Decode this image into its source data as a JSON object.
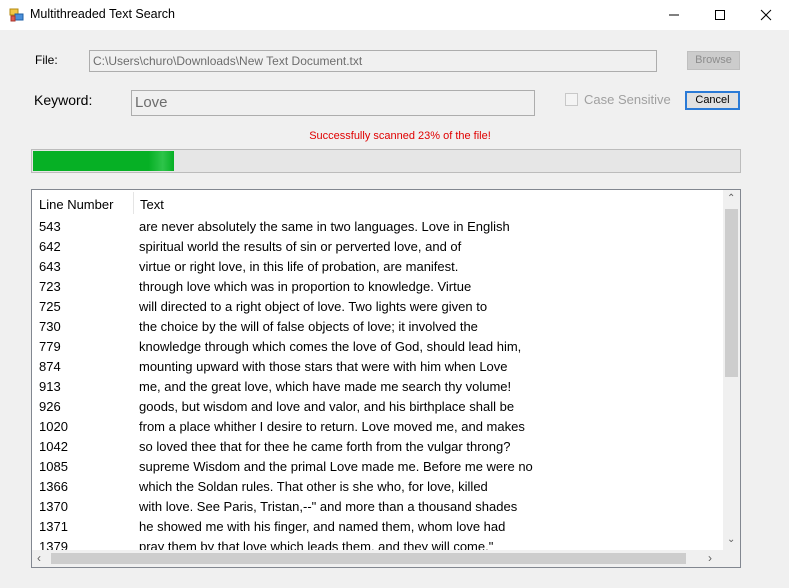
{
  "window": {
    "title": "Multithreaded Text Search"
  },
  "form": {
    "file_label": "File:",
    "file_value": "C:\\Users\\churo\\Downloads\\New Text Document.txt",
    "browse_label": "Browse",
    "keyword_label": "Keyword:",
    "keyword_value": "Love",
    "case_sensitive_label": "Case Sensitive",
    "case_sensitive_checked": false,
    "cancel_label": "Cancel"
  },
  "status": {
    "message": "Successfully scanned 23% of the file!",
    "color": "#e00000"
  },
  "progress": {
    "fraction": 0.2,
    "color": "#06b025"
  },
  "results": {
    "columns": [
      "Line Number",
      "Text"
    ],
    "rows": [
      {
        "line": "543",
        "text": "are never absolutely the same in two languages. Love in English"
      },
      {
        "line": "642",
        "text": "spiritual world the results of sin or perverted love, and of"
      },
      {
        "line": "643",
        "text": "virtue or right love, in this life of probation, are manifest."
      },
      {
        "line": "723",
        "text": "through love which was in proportion to knowledge. Virtue"
      },
      {
        "line": "725",
        "text": "will directed to a right object of love. Two lights were given to"
      },
      {
        "line": "730",
        "text": "the choice by the will of false objects of love; it involved the"
      },
      {
        "line": "779",
        "text": "knowledge through which comes the love of God, should lead him,"
      },
      {
        "line": "874",
        "text": "mounting upward with those stars that were with him when Love"
      },
      {
        "line": "913",
        "text": "me, and the great love, which have made me search thy volume!"
      },
      {
        "line": "926",
        "text": "goods, but wisdom and love and valor, and his birthplace shall be"
      },
      {
        "line": "1020",
        "text": "from a place whither I desire to return. Love moved me, and makes"
      },
      {
        "line": "1042",
        "text": "so loved thee that for thee he came forth from the vulgar throng?"
      },
      {
        "line": "1085",
        "text": "supreme Wisdom and the primal Love made me. Before me were no"
      },
      {
        "line": "1366",
        "text": "which the Soldan rules. That other is she who, for love, killed"
      },
      {
        "line": "1370",
        "text": "with love. See Paris, Tristan,--\" and more than a thousand shades"
      },
      {
        "line": "1371",
        "text": "he showed me with his finger, and named them, whom love had"
      },
      {
        "line": "1379",
        "text": "pray them by that love which leads them, and they will come.\""
      }
    ]
  }
}
